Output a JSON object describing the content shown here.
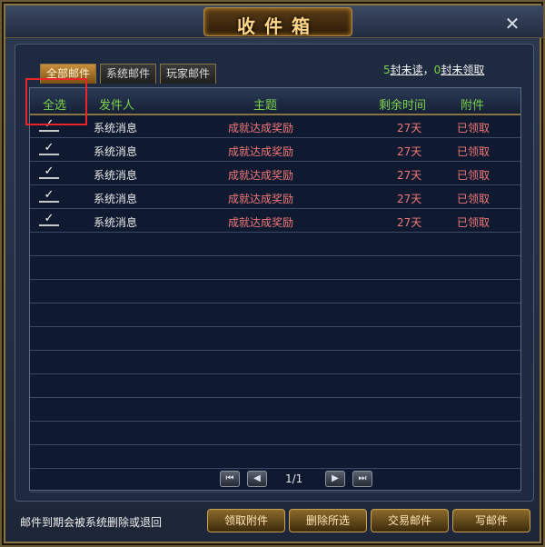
{
  "window": {
    "title": "收件箱",
    "close_symbol": "✕"
  },
  "tabs": [
    {
      "label": "全部邮件",
      "active": true
    },
    {
      "label": "系统邮件",
      "active": false
    },
    {
      "label": "玩家邮件",
      "active": false
    }
  ],
  "counts": {
    "unread_num": "5",
    "unread_label": "封未读",
    "separator": "，",
    "unclaimed_num": "0",
    "unclaimed_label": "封未领取"
  },
  "table": {
    "headers": {
      "select_all": "全选",
      "sender": "发件人",
      "subject": "主题",
      "remaining": "剩余时间",
      "attachment": "附件"
    },
    "rows": [
      {
        "checked": true,
        "sender": "系统消息",
        "subject": "成就达成奖励",
        "remaining": "27天",
        "attachment": "已领取"
      },
      {
        "checked": true,
        "sender": "系统消息",
        "subject": "成就达成奖励",
        "remaining": "27天",
        "attachment": "已领取"
      },
      {
        "checked": true,
        "sender": "系统消息",
        "subject": "成就达成奖励",
        "remaining": "27天",
        "attachment": "已领取"
      },
      {
        "checked": true,
        "sender": "系统消息",
        "subject": "成就达成奖励",
        "remaining": "27天",
        "attachment": "已领取"
      },
      {
        "checked": true,
        "sender": "系统消息",
        "subject": "成就达成奖励",
        "remaining": "27天",
        "attachment": "已领取"
      }
    ],
    "empty_rows": 11
  },
  "pager": {
    "page": "1/1",
    "first": "⏮",
    "prev": "◀",
    "next": "▶",
    "last": "⏭"
  },
  "footer": {
    "note": "邮件到期会被系统删除或退回",
    "buttons": [
      "领取附件",
      "删除所选",
      "交易邮件",
      "写邮件"
    ]
  },
  "colors": {
    "accent_green": "#7cd04a",
    "highlight_red": "#e8262a",
    "subject_red": "#f07878"
  }
}
